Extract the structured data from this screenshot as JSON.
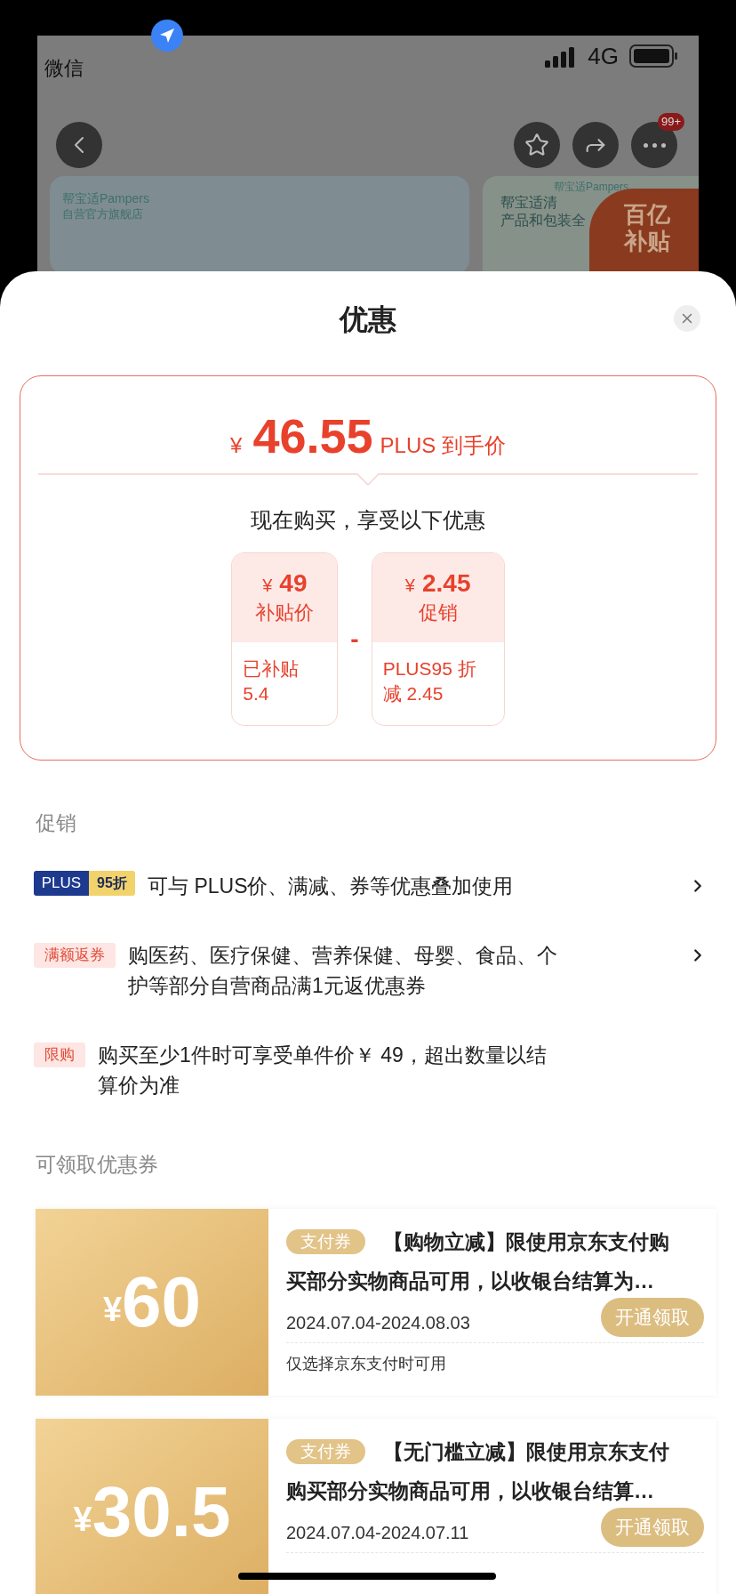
{
  "background": {
    "status_bar": {
      "back_app": "微信",
      "network": "4G"
    },
    "nav": {
      "badge": "99+"
    },
    "banners": [
      {
        "brand": "帮宝适Pampers",
        "store": "自营官方旗舰店"
      },
      {
        "brand": "帮宝适Pampers",
        "lines": [
          "帮宝适清",
          "产品和包装全"
        ],
        "sticker": [
          "百亿",
          "补贴"
        ]
      }
    ]
  },
  "sheet": {
    "title": "优惠",
    "price": {
      "currency": "¥",
      "amount": "46.55",
      "label": "PLUS 到手价"
    },
    "subtitle": "现在购买，享受以下优惠",
    "breakdown": [
      {
        "currency": "¥",
        "amount": "49",
        "label": "补贴价",
        "note": [
          "已补贴",
          "5.4"
        ]
      },
      {
        "currency": "¥",
        "amount": "2.45",
        "label": "促销",
        "note": [
          "PLUS95 折",
          "减 2.45"
        ]
      }
    ],
    "operator": "-",
    "promotions_title": "促销",
    "promotions": [
      {
        "kind": "plus",
        "tag": "PLUS",
        "tag_sub": "95折",
        "lines": [
          "可与 PLUS价、满减、券等优惠叠加使用"
        ],
        "chevron": true
      },
      {
        "kind": "label",
        "tag": "满额返券",
        "lines": [
          "购医药、医疗保健、营养保健、母婴、食品、个",
          "护等部分自营商品满1元返优惠券"
        ],
        "chevron": true
      },
      {
        "kind": "label",
        "tag": "限购",
        "lines": [
          "购买至少1件时可享受单件价￥ 49，超出数量以结",
          "算价为准"
        ],
        "chevron": false
      }
    ],
    "coupons_title": "可领取优惠券",
    "coupons": [
      {
        "currency": "¥",
        "amount": "60",
        "tag": "支付券",
        "title": [
          "【购物立减】限使用京东支付购",
          "买部分实物商品可用，以收银台结算为…"
        ],
        "date": "2024.07.04-2024.08.03",
        "button": "开通领取",
        "note": "仅选择京东支付时可用"
      },
      {
        "currency": "¥",
        "amount": "30.5",
        "tag": "支付券",
        "title": [
          "【无门槛立减】限使用京东支付",
          "购买部分实物商品可用，以收银台结算…"
        ],
        "date": "2024.07.04-2024.07.11",
        "button": "开通领取"
      }
    ]
  }
}
